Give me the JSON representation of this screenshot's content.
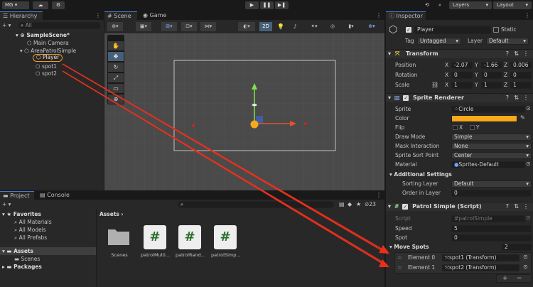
{
  "topbar": {
    "account": "MG",
    "layers": "Layers",
    "layout": "Layout"
  },
  "hierarchy": {
    "tab": "Hierarchy",
    "search": "All",
    "scene": "SampleScene*",
    "items": [
      "Main Camera",
      "AreaPatrolSimple",
      "Player",
      "spot1",
      "spot2"
    ]
  },
  "scene_view": {
    "tab_scene": "Scene",
    "tab_game": "Game",
    "mode_2d": "2D"
  },
  "project": {
    "tab_project": "Project",
    "tab_console": "Console",
    "favorites_label": "Favorites",
    "favorites": [
      "All Materials",
      "All Models",
      "All Prefabs"
    ],
    "assets_label": "Assets",
    "assets_children": [
      "Scenes"
    ],
    "packages_label": "Packages",
    "breadcrumb": "Assets",
    "count": "23",
    "files": [
      "Scenes",
      "patrolMulti...",
      "patrolRand...",
      "patrolSimp..."
    ]
  },
  "inspector": {
    "tab": "Inspector",
    "name": "Player",
    "static": "Static",
    "tag_label": "Tag",
    "tag_value": "Untagged",
    "layer_label": "Layer",
    "layer_value": "Default",
    "transform": {
      "title": "Transform",
      "position_label": "Position",
      "rotation_label": "Rotation",
      "scale_label": "Scale",
      "position": [
        "-2.07",
        "-1.66",
        "0.006"
      ],
      "rotation": [
        "0",
        "0",
        "0"
      ],
      "scale": [
        "1",
        "1",
        "1"
      ],
      "axes": [
        "X",
        "Y",
        "Z"
      ]
    },
    "sprite_renderer": {
      "title": "Sprite Renderer",
      "sprite_label": "Sprite",
      "sprite_value": "Circle",
      "color_label": "Color",
      "color_value": "#f7a81b",
      "flip_label": "Flip",
      "flip_x": "X",
      "flip_y": "Y",
      "draw_mode_label": "Draw Mode",
      "draw_mode_value": "Simple",
      "mask_label": "Mask Interaction",
      "mask_value": "None",
      "sort_point_label": "Sprite Sort Point",
      "sort_point_value": "Center",
      "material_label": "Material",
      "material_value": "Sprites-Default",
      "additional_label": "Additional Settings",
      "sorting_layer_label": "Sorting Layer",
      "sorting_layer_value": "Default",
      "order_label": "Order in Layer",
      "order_value": "0"
    },
    "patrol": {
      "title": "Patrol Simple (Script)",
      "script_label": "Script",
      "script_value": "patrolSimple",
      "speed_label": "Speed",
      "speed_value": "5",
      "spot_label": "Spot",
      "spot_value": "0",
      "move_spots_label": "Move Spots",
      "move_spots_count": "2",
      "elements": [
        {
          "label": "Element 0",
          "value": "spot1 (Transform)"
        },
        {
          "label": "Element 1",
          "value": "spot2 (Transform)"
        }
      ],
      "add": "+",
      "remove": "−"
    }
  },
  "colors": {
    "accent": "#4d78cc",
    "annotation": "#e8301c",
    "highlight": "#f29a1c",
    "sprite": "#f7a81b"
  }
}
